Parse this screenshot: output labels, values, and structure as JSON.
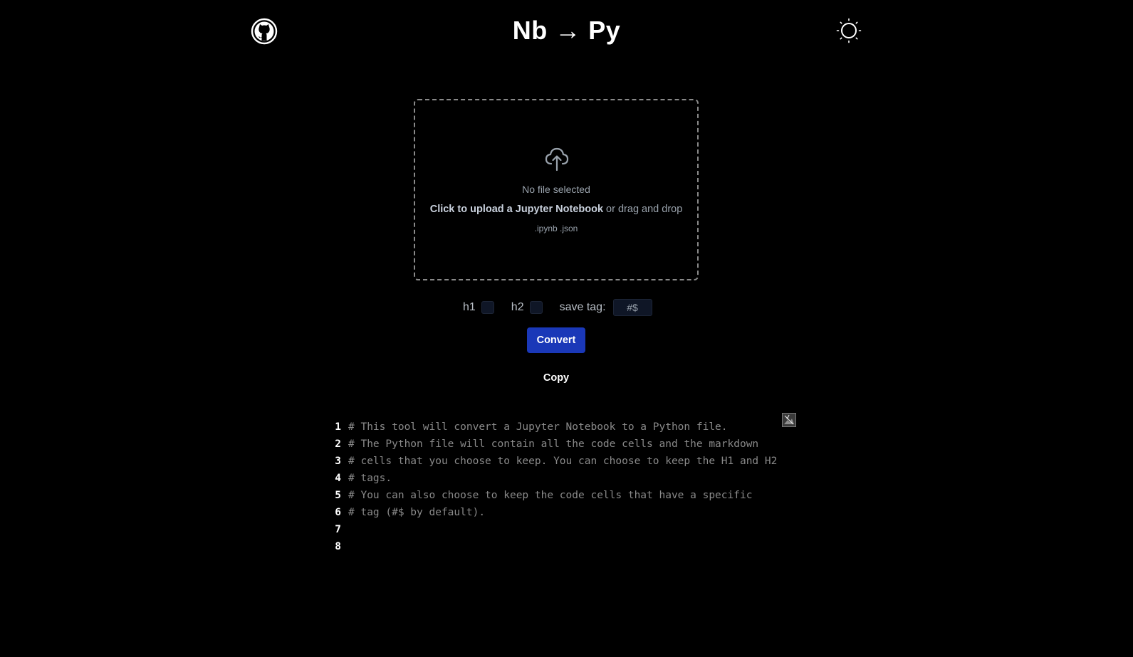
{
  "header": {
    "title": "Nb → Py",
    "github_icon": "github-icon",
    "theme_icon": "sun-icon"
  },
  "dropzone": {
    "icon": "cloud-upload-icon",
    "status": "No file selected",
    "instructions_emphasis": "Click to upload a Jupyter Notebook",
    "instructions_rest": " or drag and drop",
    "accepted_types": ".ipynb .json"
  },
  "options": {
    "h1_label": "h1",
    "h2_label": "h2",
    "save_tag_label": "save tag:",
    "save_tag_value": "#$"
  },
  "actions": {
    "convert_label": "Convert",
    "copy_label": "Copy"
  },
  "code": {
    "lines": [
      {
        "num": "1",
        "text": "# This tool will convert a Jupyter Notebook to a Python file."
      },
      {
        "num": "2",
        "text": "# The Python file will contain all the code cells and the markdown"
      },
      {
        "num": "3",
        "text": "# cells that you choose to keep. You can choose to keep the H1 and H2"
      },
      {
        "num": "4",
        "text": "# tags."
      },
      {
        "num": "5",
        "text": "# You can also choose to keep the code cells that have a specific"
      },
      {
        "num": "6",
        "text": "# tag (#$ by default)."
      },
      {
        "num": "7",
        "text": ""
      },
      {
        "num": "8",
        "text": ""
      }
    ]
  },
  "colors": {
    "background": "#000000",
    "accent": "#1a38b8",
    "muted_text": "#9aa3ad",
    "input_bg": "#0f1626"
  }
}
